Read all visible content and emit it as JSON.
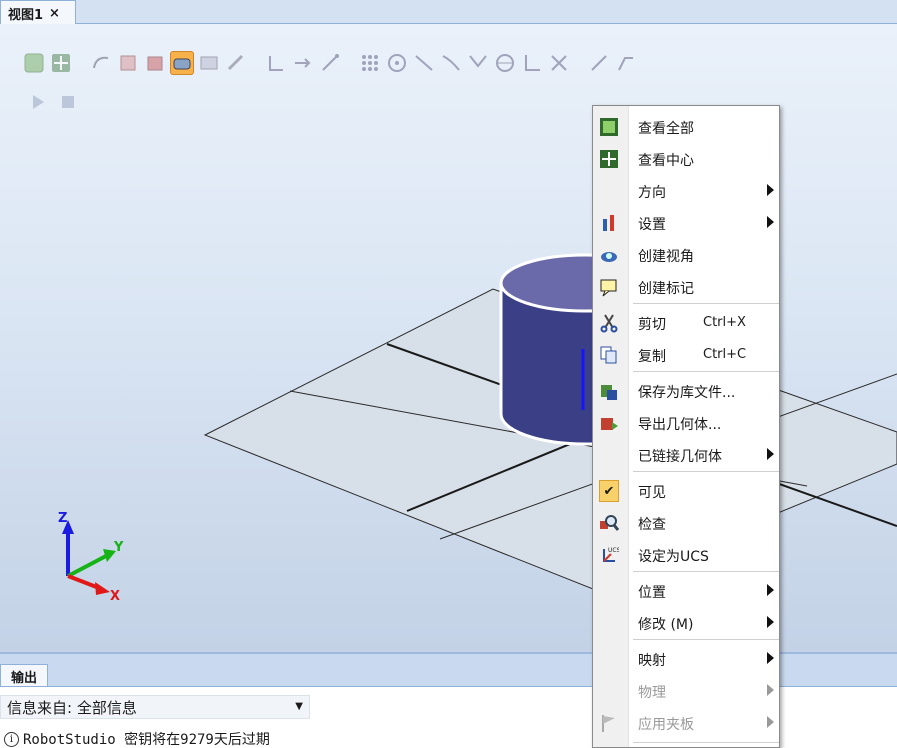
{
  "tab": {
    "title": "视图1",
    "close": "×"
  },
  "output": {
    "tab_label": "输出",
    "filter_label": "信息来自: 全部信息",
    "message": "RobotStudio 密钥将在9279天后过期",
    "info_glyph": "i"
  },
  "axes": {
    "x": "X",
    "y": "Y",
    "z": "Z"
  },
  "toolbar": {
    "icons": [
      "view-all-icon",
      "view-center-icon",
      "select-curve-icon",
      "select-surface-icon",
      "select-body-icon",
      "select-part-icon",
      "select-group-icon",
      "select-mechanism-icon",
      "select-target-icon",
      "snap-object-icon",
      "snap-center-icon",
      "snap-midpoint-icon",
      "snap-edge-icon",
      "snap-end-icon",
      "snap-grid-icon",
      "snap-local-origin-icon",
      "snap-gravity-icon",
      "measure-point-icon",
      "measure-angle-icon",
      "measure-diameter-icon"
    ],
    "active_icon": "select-part-icon",
    "playback_icons": [
      "play-icon",
      "stop-icon"
    ]
  },
  "context_menu": {
    "items": [
      {
        "label": "查看全部",
        "icon": "view-all-icon"
      },
      {
        "label": "查看中心",
        "icon": "view-center-icon"
      },
      {
        "label": "方向",
        "submenu": true
      },
      {
        "label": "设置",
        "icon": "settings-icon",
        "submenu": true
      },
      {
        "label": "创建视角",
        "icon": "camera-icon"
      },
      {
        "label": "创建标记",
        "icon": "marker-icon"
      },
      {
        "label": "剪切",
        "icon": "scissors-icon",
        "shortcut": "Ctrl+X"
      },
      {
        "label": "复制",
        "icon": "copy-icon",
        "shortcut": "Ctrl+C"
      },
      {
        "label": "保存为库文件...",
        "icon": "save-library-icon"
      },
      {
        "label": "导出几何体...",
        "icon": "export-geometry-icon"
      },
      {
        "label": "已链接几何体",
        "submenu": true
      },
      {
        "label": "可见",
        "icon": "checkmark-icon",
        "checked": true
      },
      {
        "label": "检查",
        "icon": "inspect-icon"
      },
      {
        "label": "设定为UCS",
        "icon": "ucs-icon"
      },
      {
        "label": "位置",
        "submenu": true
      },
      {
        "label": "修改 (M)",
        "submenu": true
      },
      {
        "label": "映射",
        "submenu": true
      },
      {
        "label": "物理",
        "submenu": true,
        "disabled": true
      },
      {
        "label": "应用夹板",
        "icon": "flag-icon",
        "submenu": true,
        "disabled": true
      }
    ]
  }
}
